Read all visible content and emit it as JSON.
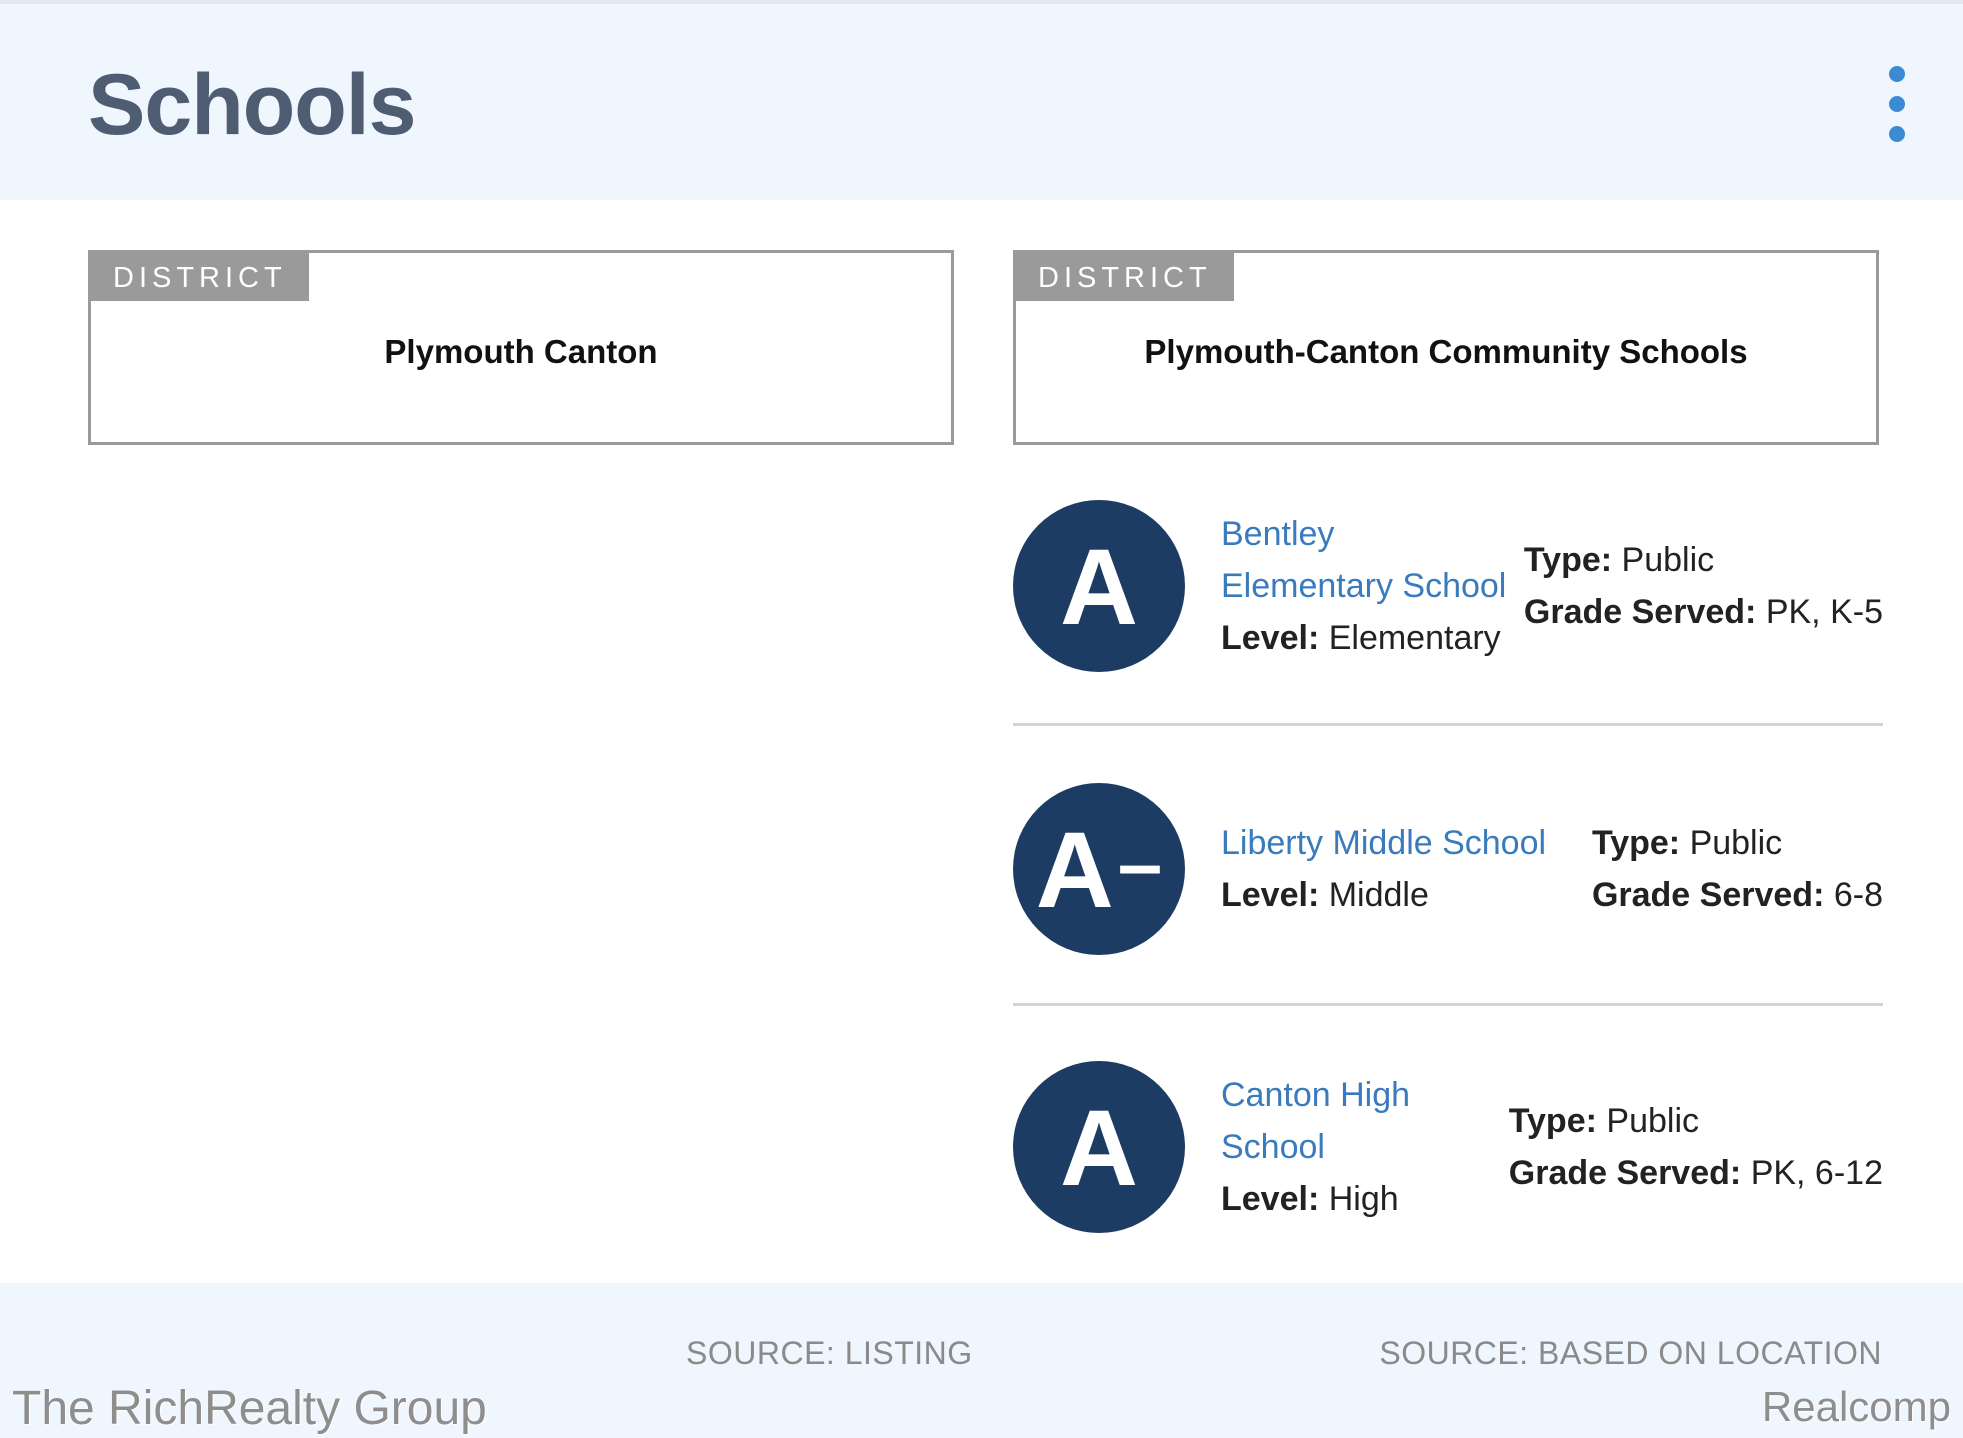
{
  "header": {
    "title": "Schools",
    "menu_icon": "more-vertical-icon"
  },
  "colors": {
    "accent": "#3b8ad6",
    "link": "#3a7bbd",
    "grade_badge": "#1d3c63",
    "header_bg": "#f0f6fd"
  },
  "districts": [
    {
      "tag": "DISTRICT",
      "name": "Plymouth Canton"
    },
    {
      "tag": "DISTRICT",
      "name": "Plymouth-Canton Community Schools"
    }
  ],
  "labels": {
    "level": "Level:",
    "type": "Type:",
    "grade_served": "Grade Served:"
  },
  "schools": [
    {
      "grade": "A",
      "grade_suffix": "",
      "name_line1": "Bentley",
      "name_line2": "Elementary School",
      "level": "Elementary",
      "type": "Public",
      "grade_served": "PK, K-5"
    },
    {
      "grade": "A",
      "grade_suffix": "–",
      "name_line1": "Liberty Middle School",
      "name_line2": "",
      "level": "Middle",
      "type": "Public",
      "grade_served": "6-8"
    },
    {
      "grade": "A",
      "grade_suffix": "",
      "name_line1": "Canton High",
      "name_line2": "School",
      "level": "High",
      "type": "Public",
      "grade_served": "PK, 6-12"
    }
  ],
  "footer": {
    "source_left": "SOURCE: LISTING",
    "source_right": "SOURCE: BASED ON LOCATION",
    "watermark_left": "The RichRealty Group",
    "watermark_right": "Realcomp"
  }
}
